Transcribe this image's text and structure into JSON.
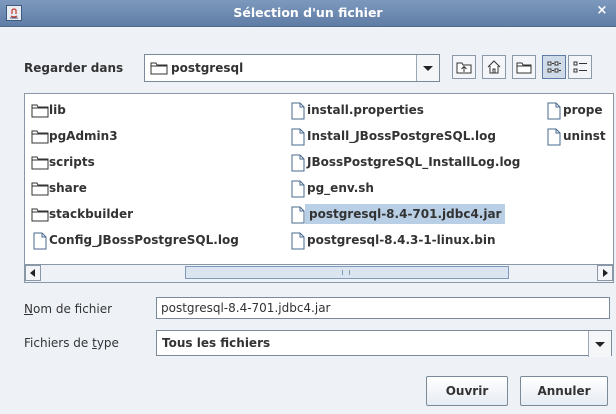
{
  "window": {
    "title": "Sélection d'un fichier",
    "close_glyph": "×"
  },
  "look_in": {
    "label": "Regarder dans",
    "value": "postgresql"
  },
  "toolbar": {
    "buttons": [
      {
        "name": "up-one-level-icon"
      },
      {
        "name": "home-icon"
      },
      {
        "name": "new-folder-icon"
      },
      {
        "name": "list-view-icon",
        "active": true
      },
      {
        "name": "details-view-icon"
      }
    ]
  },
  "files": {
    "column1": [
      {
        "name": "lib",
        "type": "folder"
      },
      {
        "name": "pgAdmin3",
        "type": "folder"
      },
      {
        "name": "scripts",
        "type": "folder"
      },
      {
        "name": "share",
        "type": "folder"
      },
      {
        "name": "stackbuilder",
        "type": "folder"
      },
      {
        "name": "Config_JBossPostgreSQL.log",
        "type": "file"
      }
    ],
    "column2": [
      {
        "name": "install.properties",
        "type": "file"
      },
      {
        "name": "Install_JBossPostgreSQL.log",
        "type": "file"
      },
      {
        "name": "JBossPostgreSQL_InstallLog.log",
        "type": "file"
      },
      {
        "name": "pg_env.sh",
        "type": "file"
      },
      {
        "name": "postgresql-8.4-701.jdbc4.jar",
        "type": "file",
        "selected": true
      },
      {
        "name": "postgresql-8.4.3-1-linux.bin",
        "type": "file"
      }
    ],
    "column3": [
      {
        "name": "prope",
        "type": "file"
      },
      {
        "name": "uninst",
        "type": "file"
      }
    ]
  },
  "filename": {
    "label_underlined": "N",
    "label_rest": "om de fichier",
    "value": "postgresql-8.4-701.jdbc4.jar"
  },
  "filetype": {
    "label_start": "Fichiers de ",
    "label_underlined": "t",
    "label_rest": "ype",
    "value": "Tous les fichiers"
  },
  "buttons": {
    "open": "Ouvrir",
    "cancel": "Annuler"
  },
  "colors": {
    "title_bar": "#6f8bb3",
    "selection": "#b8cfe5",
    "background": "#eef2f7"
  }
}
